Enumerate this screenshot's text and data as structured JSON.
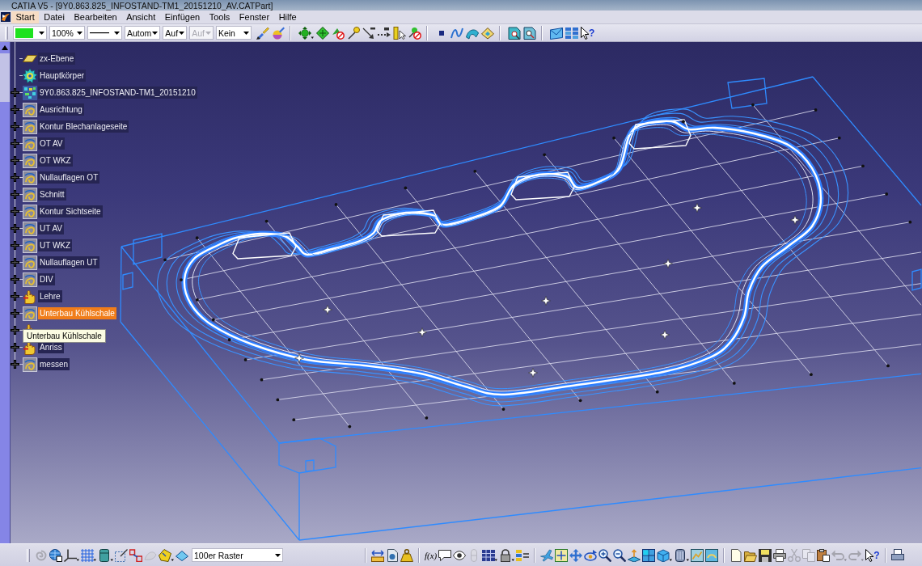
{
  "window": {
    "title": "CATIA V5 - [9Y0.863.825_INFOSTAND-TM1_20151210_AV.CATPart]"
  },
  "menu": [
    {
      "label": "Start",
      "selected": true
    },
    {
      "label": "Datei",
      "selected": false
    },
    {
      "label": "Bearbeiten",
      "selected": false
    },
    {
      "label": "Ansicht",
      "selected": false
    },
    {
      "label": "Einfügen",
      "selected": false
    },
    {
      "label": "Tools",
      "selected": false
    },
    {
      "label": "Fenster",
      "selected": false
    },
    {
      "label": "Hilfe",
      "selected": false
    }
  ],
  "toolbar": {
    "combos": [
      {
        "kind": "color",
        "color": "#1ee21e",
        "disabled": false
      },
      {
        "kind": "text",
        "value": "100%",
        "disabled": false
      },
      {
        "kind": "line",
        "disabled": false
      },
      {
        "kind": "text",
        "value": "Autom",
        "disabled": false
      },
      {
        "kind": "text",
        "value": "Auf",
        "disabled": false
      },
      {
        "kind": "text",
        "value": "Auf",
        "disabled": true
      },
      {
        "kind": "text",
        "value": "Kein",
        "disabled": false
      }
    ],
    "help_button": {
      "label": "?"
    }
  },
  "tree": {
    "items": [
      {
        "label": "zx-Ebene",
        "kind": "plane",
        "expander": false,
        "selected": false
      },
      {
        "label": "Hauptkörper",
        "kind": "body",
        "expander": false,
        "selected": false
      },
      {
        "label": "9Y0.863.825_INFOSTAND-TM1_20151210",
        "kind": "part",
        "expander": true,
        "selected": false
      },
      {
        "label": "Ausrichtung",
        "kind": "set",
        "expander": true,
        "selected": false
      },
      {
        "label": "Kontur Blechanlageseite",
        "kind": "set",
        "expander": true,
        "selected": false
      },
      {
        "label": "OT AV",
        "kind": "set",
        "expander": true,
        "selected": false
      },
      {
        "label": "OT WKZ",
        "kind": "set",
        "expander": true,
        "selected": false
      },
      {
        "label": "Nullauflagen OT",
        "kind": "set",
        "expander": true,
        "selected": false
      },
      {
        "label": "Schnitt",
        "kind": "set",
        "expander": true,
        "selected": false
      },
      {
        "label": "Kontur Sichtseite",
        "kind": "set",
        "expander": true,
        "selected": false
      },
      {
        "label": "UT AV",
        "kind": "set",
        "expander": true,
        "selected": false
      },
      {
        "label": "UT WKZ",
        "kind": "set",
        "expander": true,
        "selected": false
      },
      {
        "label": "Nullauflagen UT",
        "kind": "set",
        "expander": true,
        "selected": false
      },
      {
        "label": "DIV",
        "kind": "set",
        "expander": true,
        "selected": false
      },
      {
        "label": "Lehre",
        "kind": "tool",
        "expander": true,
        "selected": false
      },
      {
        "label": "Unterbau Kühlschale",
        "kind": "set",
        "expander": true,
        "selected": true
      },
      {
        "kind": "tool",
        "expander": true,
        "selected": false
      },
      {
        "label": "Anriss",
        "kind": "tool",
        "expander": true,
        "selected": false
      },
      {
        "label": "messen",
        "kind": "set",
        "expander": true,
        "selected": false
      }
    ]
  },
  "tooltip": {
    "text": "Unterbau Kühlschale"
  },
  "bottom_toolbar": {
    "groups": [
      [
        {
          "disabled": true
        },
        {
          "disabled": false
        },
        {
          "disabled": false
        },
        {
          "disabled": false
        },
        {
          "disabled": false
        },
        {
          "disabled": false
        },
        {
          "disabled": false
        },
        {
          "disabled": true
        },
        {
          "disabled": false
        },
        {
          "disabled": false
        }
      ],
      [
        {
          "disabled": false
        },
        {
          "disabled": false
        },
        {
          "disabled": false
        }
      ],
      [
        {
          "label": "f(x)",
          "disabled": false
        },
        {
          "disabled": false
        },
        {
          "disabled": false
        },
        {
          "disabled": true
        },
        {
          "disabled": false
        },
        {
          "disabled": false
        },
        {
          "disabled": false
        }
      ],
      [
        {
          "disabled": false
        },
        {
          "disabled": false
        },
        {
          "disabled": false
        },
        {
          "disabled": false
        },
        {
          "disabled": false
        },
        {
          "disabled": false
        },
        {
          "disabled": false
        },
        {
          "disabled": false
        },
        {
          "disabled": false
        },
        {
          "disabled": false
        },
        {
          "disabled": false
        },
        {
          "disabled": false
        }
      ],
      [
        {
          "disabled": false
        },
        {
          "disabled": false
        },
        {
          "disabled": false
        },
        {
          "disabled": false
        },
        {
          "disabled": true
        },
        {
          "disabled": true
        },
        {
          "disabled": false
        },
        {
          "disabled": true
        },
        {
          "disabled": true
        },
        {
          "label": "?",
          "disabled": false
        }
      ],
      [
        {
          "disabled": false
        }
      ]
    ],
    "raster_combo": {
      "value": "100er Raster"
    }
  }
}
